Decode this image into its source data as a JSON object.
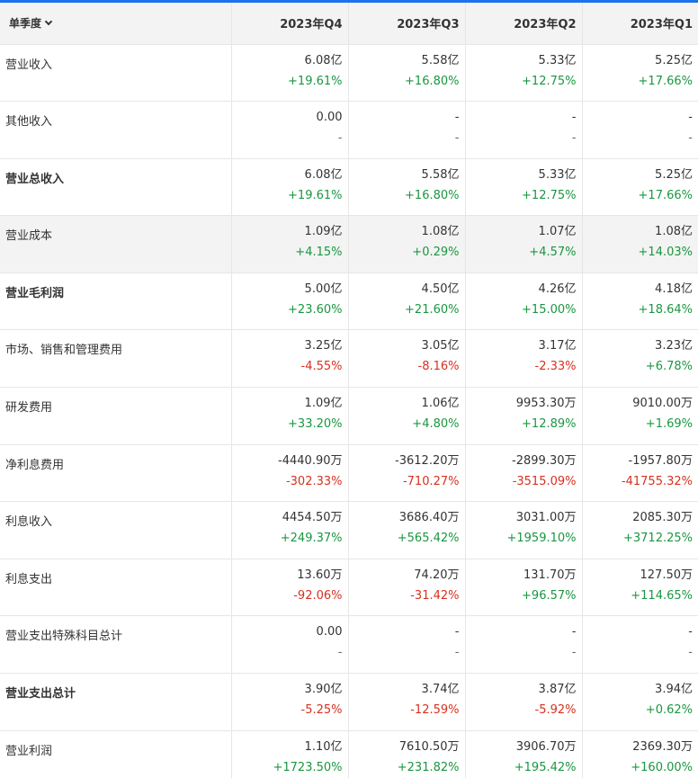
{
  "header": {
    "period_label": "单季度",
    "columns": [
      "2023年Q4",
      "2023年Q3",
      "2023年Q2",
      "2023年Q1"
    ]
  },
  "rows": [
    {
      "label": "营业收入",
      "bold": false,
      "alt": false,
      "cells": [
        {
          "v": "6.08亿",
          "g": "+19.61%",
          "t": "up"
        },
        {
          "v": "5.58亿",
          "g": "+16.80%",
          "t": "up"
        },
        {
          "v": "5.33亿",
          "g": "+12.75%",
          "t": "up"
        },
        {
          "v": "5.25亿",
          "g": "+17.66%",
          "t": "up"
        }
      ]
    },
    {
      "label": "其他收入",
      "bold": false,
      "alt": false,
      "cells": [
        {
          "v": "0.00",
          "g": "-",
          "t": "na"
        },
        {
          "v": "-",
          "g": "-",
          "t": "na"
        },
        {
          "v": "-",
          "g": "-",
          "t": "na"
        },
        {
          "v": "-",
          "g": "-",
          "t": "na"
        }
      ]
    },
    {
      "label": "营业总收入",
      "bold": true,
      "alt": false,
      "cells": [
        {
          "v": "6.08亿",
          "g": "+19.61%",
          "t": "up"
        },
        {
          "v": "5.58亿",
          "g": "+16.80%",
          "t": "up"
        },
        {
          "v": "5.33亿",
          "g": "+12.75%",
          "t": "up"
        },
        {
          "v": "5.25亿",
          "g": "+17.66%",
          "t": "up"
        }
      ]
    },
    {
      "label": "营业成本",
      "bold": false,
      "alt": true,
      "cells": [
        {
          "v": "1.09亿",
          "g": "+4.15%",
          "t": "up"
        },
        {
          "v": "1.08亿",
          "g": "+0.29%",
          "t": "up"
        },
        {
          "v": "1.07亿",
          "g": "+4.57%",
          "t": "up"
        },
        {
          "v": "1.08亿",
          "g": "+14.03%",
          "t": "up"
        }
      ]
    },
    {
      "label": "营业毛利润",
      "bold": true,
      "alt": false,
      "cells": [
        {
          "v": "5.00亿",
          "g": "+23.60%",
          "t": "up"
        },
        {
          "v": "4.50亿",
          "g": "+21.60%",
          "t": "up"
        },
        {
          "v": "4.26亿",
          "g": "+15.00%",
          "t": "up"
        },
        {
          "v": "4.18亿",
          "g": "+18.64%",
          "t": "up"
        }
      ]
    },
    {
      "label": "市场、销售和管理费用",
      "bold": false,
      "alt": false,
      "cells": [
        {
          "v": "3.25亿",
          "g": "-4.55%",
          "t": "down"
        },
        {
          "v": "3.05亿",
          "g": "-8.16%",
          "t": "down"
        },
        {
          "v": "3.17亿",
          "g": "-2.33%",
          "t": "down"
        },
        {
          "v": "3.23亿",
          "g": "+6.78%",
          "t": "up"
        }
      ]
    },
    {
      "label": "研发费用",
      "bold": false,
      "alt": false,
      "cells": [
        {
          "v": "1.09亿",
          "g": "+33.20%",
          "t": "up"
        },
        {
          "v": "1.06亿",
          "g": "+4.80%",
          "t": "up"
        },
        {
          "v": "9953.30万",
          "g": "+12.89%",
          "t": "up"
        },
        {
          "v": "9010.00万",
          "g": "+1.69%",
          "t": "up"
        }
      ]
    },
    {
      "label": "净利息费用",
      "bold": false,
      "alt": false,
      "cells": [
        {
          "v": "-4440.90万",
          "g": "-302.33%",
          "t": "down"
        },
        {
          "v": "-3612.20万",
          "g": "-710.27%",
          "t": "down"
        },
        {
          "v": "-2899.30万",
          "g": "-3515.09%",
          "t": "down"
        },
        {
          "v": "-1957.80万",
          "g": "-41755.32%",
          "t": "down"
        }
      ]
    },
    {
      "label": "利息收入",
      "bold": false,
      "alt": false,
      "cells": [
        {
          "v": "4454.50万",
          "g": "+249.37%",
          "t": "up"
        },
        {
          "v": "3686.40万",
          "g": "+565.42%",
          "t": "up"
        },
        {
          "v": "3031.00万",
          "g": "+1959.10%",
          "t": "up"
        },
        {
          "v": "2085.30万",
          "g": "+3712.25%",
          "t": "up"
        }
      ]
    },
    {
      "label": "利息支出",
      "bold": false,
      "alt": false,
      "cells": [
        {
          "v": "13.60万",
          "g": "-92.06%",
          "t": "down"
        },
        {
          "v": "74.20万",
          "g": "-31.42%",
          "t": "down"
        },
        {
          "v": "131.70万",
          "g": "+96.57%",
          "t": "up"
        },
        {
          "v": "127.50万",
          "g": "+114.65%",
          "t": "up"
        }
      ]
    },
    {
      "label": "营业支出特殊科目总计",
      "bold": false,
      "alt": false,
      "cells": [
        {
          "v": "0.00",
          "g": "-",
          "t": "na"
        },
        {
          "v": "-",
          "g": "-",
          "t": "na"
        },
        {
          "v": "-",
          "g": "-",
          "t": "na"
        },
        {
          "v": "-",
          "g": "-",
          "t": "na"
        }
      ]
    },
    {
      "label": "营业支出总计",
      "bold": true,
      "alt": false,
      "cells": [
        {
          "v": "3.90亿",
          "g": "-5.25%",
          "t": "down"
        },
        {
          "v": "3.74亿",
          "g": "-12.59%",
          "t": "down"
        },
        {
          "v": "3.87亿",
          "g": "-5.92%",
          "t": "down"
        },
        {
          "v": "3.94亿",
          "g": "+0.62%",
          "t": "up"
        }
      ]
    },
    {
      "label": "营业利润",
      "bold": false,
      "alt": false,
      "cells": [
        {
          "v": "1.10亿",
          "g": "+1723.50%",
          "t": "up"
        },
        {
          "v": "7610.50万",
          "g": "+231.82%",
          "t": "up"
        },
        {
          "v": "3906.70万",
          "g": "+195.42%",
          "t": "up"
        },
        {
          "v": "2369.30万",
          "g": "+160.00%",
          "t": "up"
        }
      ]
    }
  ],
  "colors": {
    "up": "#1a9641",
    "down": "#d7301f",
    "header_bg": "#f3f3f3",
    "accent": "#1a73e8"
  }
}
